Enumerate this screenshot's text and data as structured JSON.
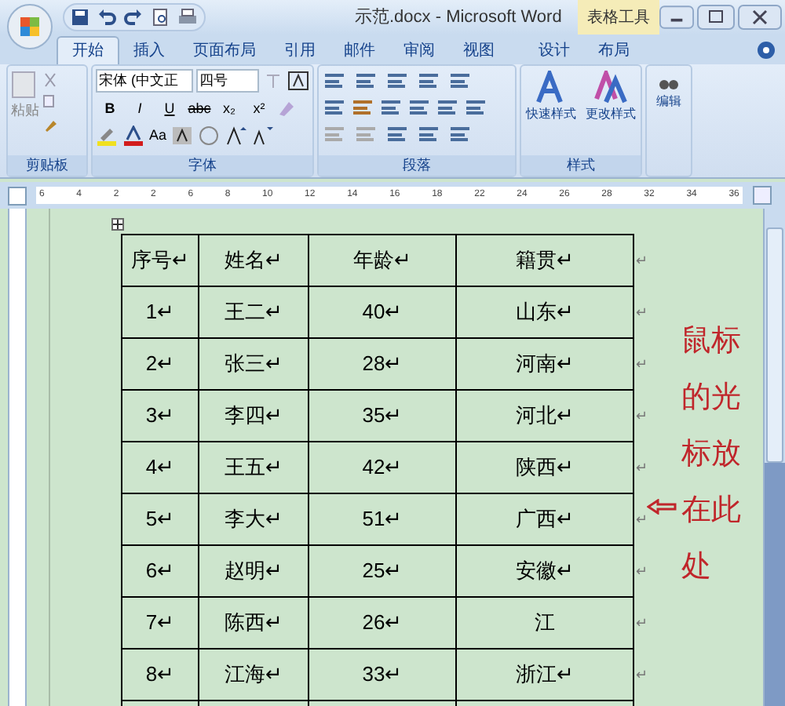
{
  "window": {
    "title": "示范.docx - Microsoft Word",
    "context_tab": "表格工具"
  },
  "tabs": [
    {
      "label": "开始",
      "selected": true
    },
    {
      "label": "插入",
      "selected": false
    },
    {
      "label": "页面布局",
      "selected": false
    },
    {
      "label": "引用",
      "selected": false
    },
    {
      "label": "邮件",
      "selected": false
    },
    {
      "label": "审阅",
      "selected": false
    },
    {
      "label": "视图",
      "selected": false
    },
    {
      "label": "设计",
      "selected": false
    },
    {
      "label": "布局",
      "selected": false
    }
  ],
  "clipboard": {
    "paste": "粘贴",
    "label": "剪贴板"
  },
  "font": {
    "name": "宋体 (中文正",
    "size": "四号",
    "label": "字体",
    "buttons": [
      "B",
      "I",
      "U",
      "abc",
      "x₂",
      "x²"
    ],
    "case": "Aa"
  },
  "paragraph": {
    "label": "段落"
  },
  "styles": {
    "quick": "快速样式",
    "change": "更改样式",
    "label": "样式"
  },
  "editing": {
    "label": "编辑"
  },
  "ruler": [
    "6",
    "4",
    "2",
    "2",
    "6",
    "8",
    "10",
    "12",
    "14",
    "16",
    "18",
    "22",
    "24",
    "26",
    "28",
    "32",
    "34",
    "36"
  ],
  "table": {
    "columns": [
      "序号↵",
      "姓名↵",
      "年龄↵",
      "籍贯↵"
    ],
    "header_end": "↵",
    "rows": [
      {
        "cells": [
          "1↵",
          "王二↵",
          "40↵",
          "山东↵"
        ],
        "end": "↵"
      },
      {
        "cells": [
          "2↵",
          "张三↵",
          "28↵",
          "河南↵"
        ],
        "end": "↵"
      },
      {
        "cells": [
          "3↵",
          "李四↵",
          "35↵",
          "河北↵"
        ],
        "end": "↵"
      },
      {
        "cells": [
          "4↵",
          "王五↵",
          "42↵",
          "陕西↵"
        ],
        "end": "↵"
      },
      {
        "cells": [
          "5↵",
          "李大↵",
          "51↵",
          "广西↵"
        ],
        "end": "↵"
      },
      {
        "cells": [
          "6↵",
          "赵明↵",
          "25↵",
          "安徽↵"
        ],
        "end": "↵"
      },
      {
        "cells": [
          "7↵",
          "陈西↵",
          "26↵",
          "江"
        ],
        "end": "↵"
      },
      {
        "cells": [
          "8↵",
          "江海↵",
          "33↵",
          "浙江↵"
        ],
        "end": "↵"
      }
    ]
  },
  "annotation": {
    "text": "鼠标的光标放在此处"
  }
}
